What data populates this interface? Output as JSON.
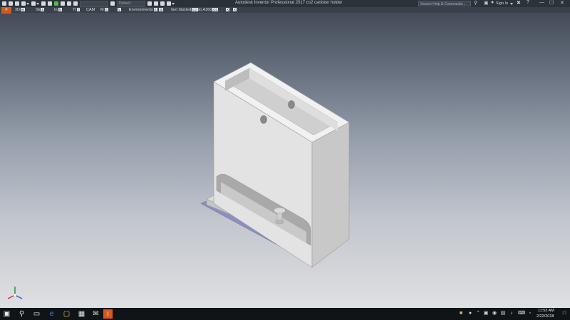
{
  "window": {
    "app_title": "Autodesk Inventor Professional 2017 co2 canister holder",
    "combo_material": "",
    "combo_appearance": "Default"
  },
  "search": {
    "placeholder": "Search Help & Commands..."
  },
  "account": {
    "sign_in": "Sign In"
  },
  "ribbon": {
    "file_key": "F",
    "tabs": [
      {
        "label": "3D",
        "key": "M"
      },
      {
        "label": "Sk",
        "key": "S"
      },
      {
        "label": "In",
        "key": "N"
      },
      {
        "label": "Tl",
        "key": "T"
      },
      {
        "label": "CAM",
        "key": ""
      },
      {
        "label": "M",
        "key": "G"
      },
      {
        "label": "Environments",
        "key": "E"
      },
      {
        "label": "Get Started",
        "key": "GS"
      },
      {
        "label": "Auto A360",
        "key": "DL"
      }
    ]
  },
  "icons": {
    "search": "search-icon",
    "cart": "cart-icon",
    "user": "user-icon",
    "help": "help-icon",
    "axis": "view-cube-axis-icon"
  },
  "colors": {
    "model_light": "#e4e4e4",
    "model_mid": "#cfcfcf",
    "model_dark": "#b4b4b4",
    "base_plate": "#8c90c0",
    "file_tab": "#d35a1c"
  },
  "taskbar": {
    "time": "11:53 AM",
    "date": "2/22/2018"
  }
}
